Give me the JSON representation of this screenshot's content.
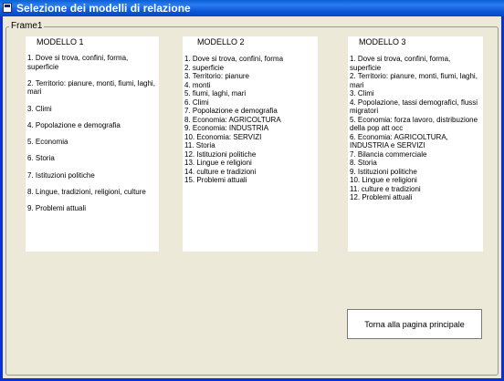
{
  "window": {
    "title": "Selezione dei modelli di relazione"
  },
  "frame": {
    "label": "Frame1"
  },
  "models": [
    {
      "heading": "MODELLO 1",
      "items": [
        "1. Dove si trova, confini, forma, superficie",
        "2. Territorio: pianure, monti, fiumi, laghi, mari",
        "3. Climi",
        "4. Popolazione e demografia",
        "5. Economia",
        "6. Storia",
        "7. Istituzioni politiche",
        "8. Lingue, tradizioni, religioni, culture",
        "9. Problemi attuali"
      ]
    },
    {
      "heading": "MODELLO 2",
      "items": [
        "1. Dove si trova, confini, forma",
        "2. superficie",
        "3. Territorio: pianure",
        "4. monti",
        "5. fiumi, laghi, mari",
        "6. Climi",
        "7. Popolazione e demografia",
        "8. Economia: AGRICOLTURA",
        "9. Economia: INDUSTRIA",
        "10. Economia:  SERVIZI",
        "11. Storia",
        "12. Istituzioni politiche",
        "13. Lingue e religioni",
        "14. culture e tradizioni",
        "15. Problemi attuali"
      ]
    },
    {
      "heading": "MODELLO 3",
      "items": [
        "1. Dove si trova, confini, forma, superficie",
        "2. Territorio: pianure, monti, fiumi, laghi, mari",
        "3. Climi",
        "4. Popolazione, tassi demografici, flussi migratori",
        "5. Economia: forza lavoro, distribuzione della pop att occ",
        "6. Economia: AGRICOLTURA, INDUSTRIA e SERVIZI",
        "7. Bilancia commerciale",
        "8. Storia",
        "9. Istituzioni politiche",
        "10. Lingue e religioni",
        "11. culture e tradizioni",
        "12. Problemi attuali"
      ]
    }
  ],
  "buttons": {
    "back_label": "Torna alla pagina principale"
  }
}
